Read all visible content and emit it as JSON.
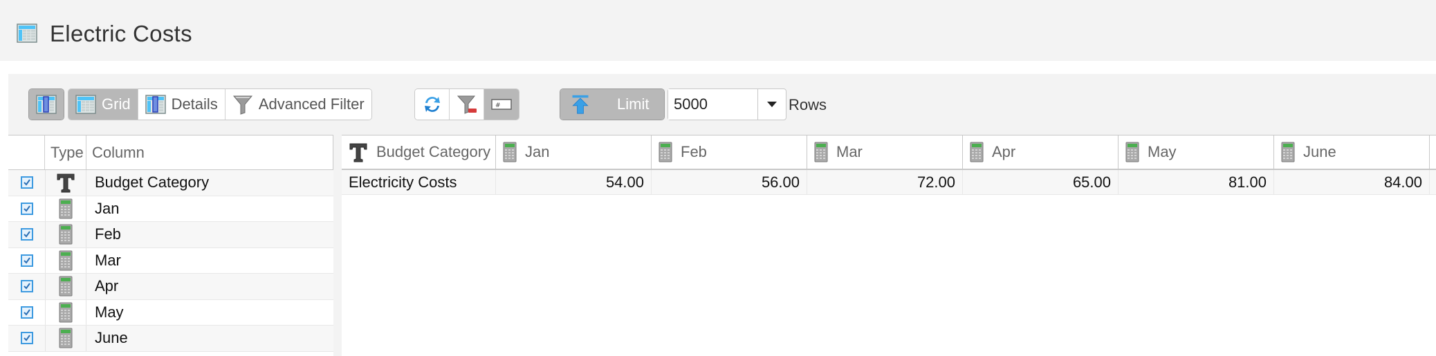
{
  "window": {
    "title": "Electric Costs",
    "icon": "table-icon"
  },
  "toolbar": {
    "view_toggle": {
      "icon": "column-view-icon",
      "active": true
    },
    "views": [
      {
        "label": "Grid",
        "icon": "grid-icon",
        "active": true
      },
      {
        "label": "Details",
        "icon": "details-icon",
        "active": false
      },
      {
        "label": "Advanced Filter",
        "icon": "funnel-icon",
        "active": false
      }
    ],
    "actions": [
      {
        "name": "refresh",
        "icon": "refresh-icon",
        "active": false
      },
      {
        "name": "clear-filter",
        "icon": "funnel-remove-icon",
        "active": false
      },
      {
        "name": "row-number",
        "icon": "row-number-icon",
        "active": true
      }
    ],
    "limit": {
      "label": "Limit",
      "icon": "arrow-up-to-top-icon",
      "active": true,
      "value": "5000",
      "suffix": "Rows"
    }
  },
  "column_list": {
    "headers": {
      "check": "",
      "type": "Type",
      "column": "Column"
    },
    "rows": [
      {
        "name": "Budget Category",
        "type": "text",
        "checked": true
      },
      {
        "name": "Jan",
        "type": "number",
        "checked": true
      },
      {
        "name": "Feb",
        "type": "number",
        "checked": true
      },
      {
        "name": "Mar",
        "type": "number",
        "checked": true
      },
      {
        "name": "Apr",
        "type": "number",
        "checked": true
      },
      {
        "name": "May",
        "type": "number",
        "checked": true
      },
      {
        "name": "June",
        "type": "number",
        "checked": true
      }
    ]
  },
  "grid": {
    "columns": [
      {
        "label": "Budget Category",
        "type": "text"
      },
      {
        "label": "Jan",
        "type": "number"
      },
      {
        "label": "Feb",
        "type": "number"
      },
      {
        "label": "Mar",
        "type": "number"
      },
      {
        "label": "Apr",
        "type": "number"
      },
      {
        "label": "May",
        "type": "number"
      },
      {
        "label": "June",
        "type": "number"
      }
    ],
    "rows": [
      [
        "Electricity Costs",
        "54.00",
        "56.00",
        "72.00",
        "65.00",
        "81.00",
        "84.00"
      ]
    ]
  },
  "colors": {
    "active_button": "#b8b8b8",
    "checkbox_accent": "#3d9ae0",
    "panel_bg": "#f3f3f3"
  }
}
